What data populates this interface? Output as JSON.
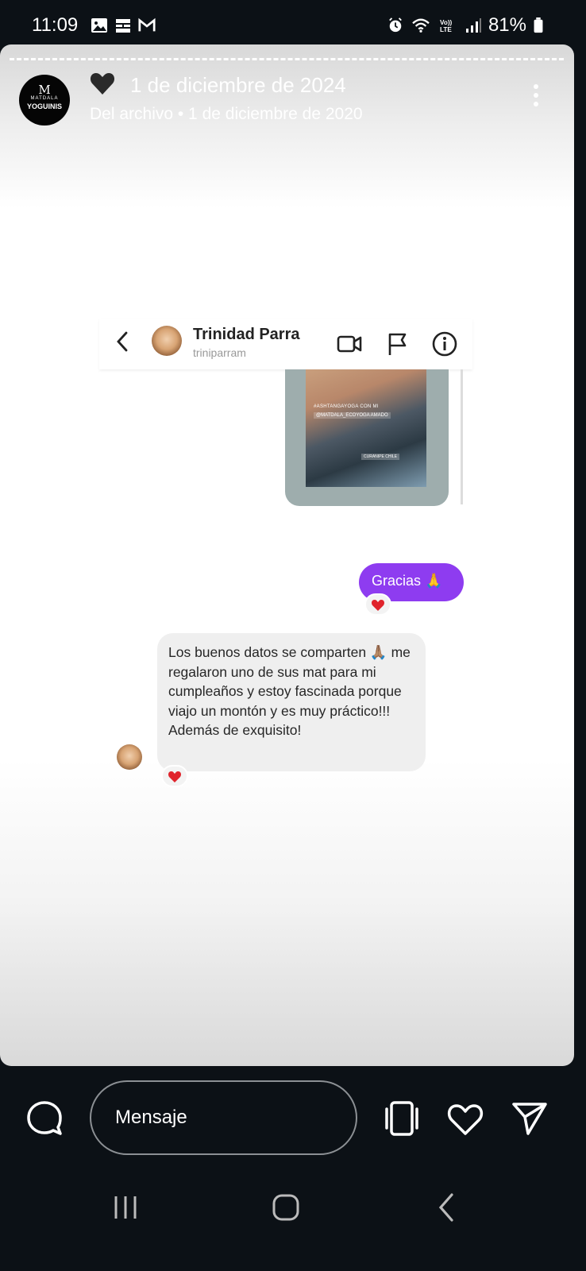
{
  "status_bar": {
    "time": "11:09",
    "battery": "81%",
    "left_icons": [
      "gallery-icon",
      "cast-icon",
      "gmail-icon"
    ],
    "right_icons": [
      "alarm-icon",
      "wifi-icon",
      "volte-icon",
      "signal-icon",
      "battery-icon"
    ]
  },
  "story": {
    "account_logo": {
      "top": "MATDALA",
      "bottom": "YOGUINIS"
    },
    "date": "1 de diciembre de 2024",
    "archive_note": "Del archivo • 1 de diciembre de 2020"
  },
  "chat": {
    "contact_name": "Trinidad Parra",
    "contact_handle": "triniparram",
    "shared_post": {
      "tag_line1": "#ASHTANGAYOGA CON MI",
      "tag_line2": "@MATDALA_ECOYOGA AMADO",
      "tag_line3": "CURANIPE CHILE"
    },
    "sent_message": "Gracias 🙏",
    "received_message": "Los buenos datos se comparten 🙏🏽 me regalaron uno de sus mat para mi cumpleaños y estoy fascinada porque viajo un montón y es muy práctico!!! Además de exquisito!"
  },
  "bottom_bar": {
    "message_placeholder": "Mensaje"
  },
  "colors": {
    "sent_bubble": "#8e3cf0",
    "received_bubble": "#efefef",
    "reaction_heart": "#e0242c",
    "background": "#0c1116"
  }
}
